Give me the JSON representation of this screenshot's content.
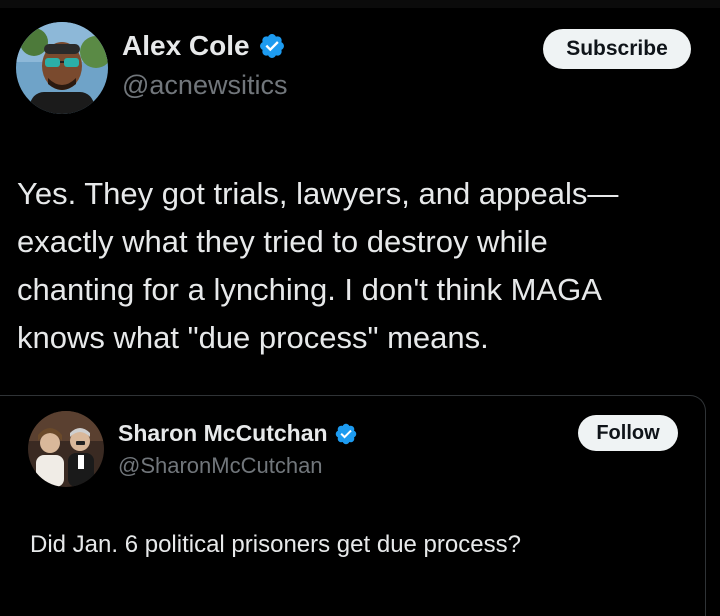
{
  "main_tweet": {
    "author_name": "Alex Cole",
    "author_handle": "@acnewsitics",
    "verified": true,
    "subscribe_label": "Subscribe",
    "text_lines": [
      "Yes. They got trials, lawyers, and appeals—",
      "exactly what they tried to destroy while",
      "chanting for a lynching. I don't think MAGA",
      "knows what \"due process\" means."
    ]
  },
  "quoted_tweet": {
    "author_name": "Sharon McCutchan",
    "author_handle": "@SharonMcCutchan",
    "verified": true,
    "follow_label": "Follow",
    "text": "Did Jan. 6 political prisoners get due process?"
  },
  "icons": {
    "verified_badge": "verified-badge-icon"
  },
  "colors": {
    "background": "#000000",
    "primary_text": "#e7e9ea",
    "secondary_text": "#71767b",
    "verified_blue": "#1d9bf0",
    "button_bg": "#eff3f4",
    "button_text": "#0f1419",
    "border": "#2f3336"
  }
}
